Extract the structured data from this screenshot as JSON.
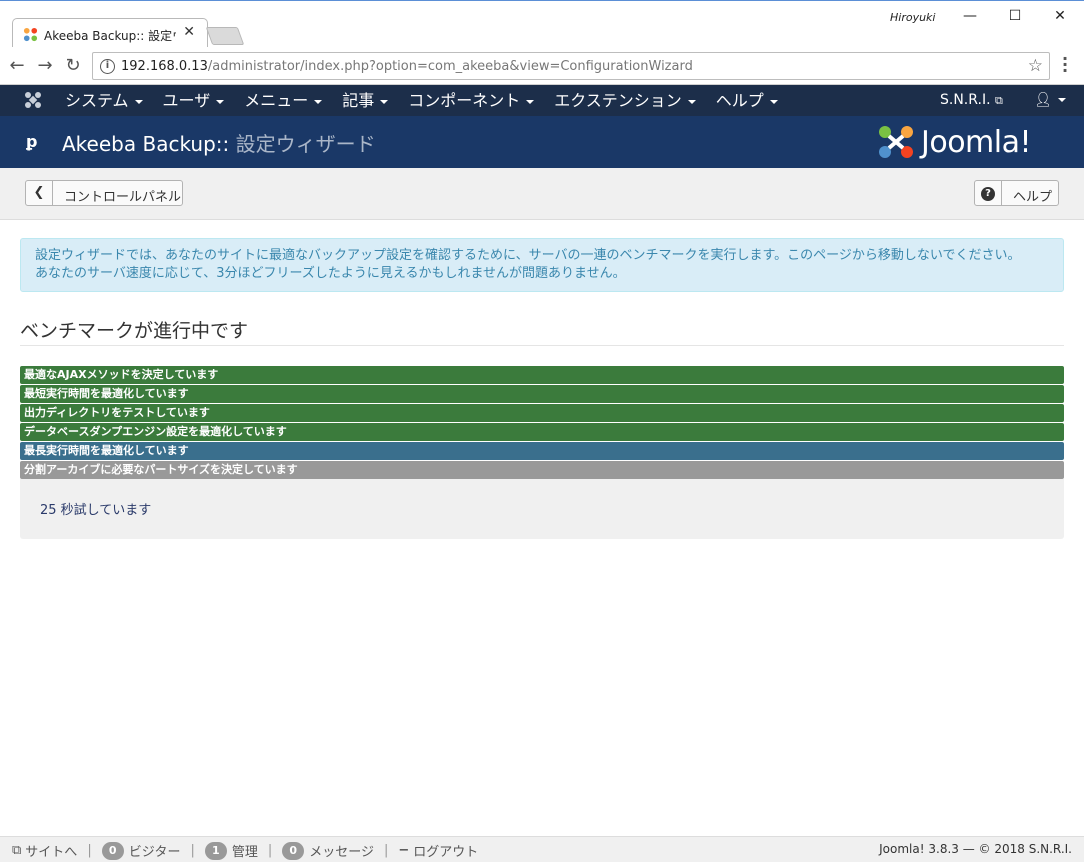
{
  "browser": {
    "tab_title": "Akeeba Backup:: 設定ウィ",
    "window_user": "Hiroyuki",
    "url_host": "192.168.0.13",
    "url_path": "/administrator/index.php?option=com_akeeba&view=ConfigurationWizard"
  },
  "admin_menu": {
    "items": [
      "システム",
      "ユーザ",
      "メニュー",
      "記事",
      "コンポーネント",
      "エクステンション",
      "ヘルプ"
    ],
    "site_link": "S.N.R.I."
  },
  "header": {
    "title_main": "Akeeba Backup::",
    "title_sub": " 設定ウィザード",
    "brand": "Joomla!"
  },
  "toolbar": {
    "back_label": "コントロールパネル",
    "help_label": "ヘルプ"
  },
  "alert": {
    "line1": "設定ウィザードでは、あなたのサイトに最適なバックアップ設定を確認するために、サーバの一連のベンチマークを実行します。このページから移動しないでください。",
    "line2": "あなたのサーバ速度に応じて、3分ほどフリーズしたように見えるかもしれませんが問題ありません。"
  },
  "main": {
    "heading": "ベンチマークが進行中です",
    "steps": [
      {
        "label": "最適なAJAXメソッドを決定しています",
        "state": "done"
      },
      {
        "label": "最短実行時間を最適化しています",
        "state": "done"
      },
      {
        "label": "出力ディレクトリをテストしています",
        "state": "done"
      },
      {
        "label": "データベースダンプエンジン設定を最適化しています",
        "state": "done"
      },
      {
        "label": "最長実行時間を最適化しています",
        "state": "active"
      },
      {
        "label": "分割アーカイブに必要なパートサイズを決定しています",
        "state": "pending"
      }
    ],
    "status_text": "25 秒試しています"
  },
  "footer": {
    "site_link": "サイトへ",
    "visitors_count": "0",
    "visitors_label": "ビジター",
    "admins_count": "1",
    "admins_label": "管理",
    "messages_count": "0",
    "messages_label": "メッセージ",
    "logout_label": "ログアウト",
    "version": "Joomla! 3.8.3  —  © 2018 S.N.R.I."
  },
  "colors": {
    "nav_bg": "#1c2e4a",
    "header_bg": "#1a3867",
    "step_done": "#3b7b3c",
    "step_active": "#3a6f8d",
    "step_pending": "#999999",
    "alert_bg": "#d9edf7"
  }
}
